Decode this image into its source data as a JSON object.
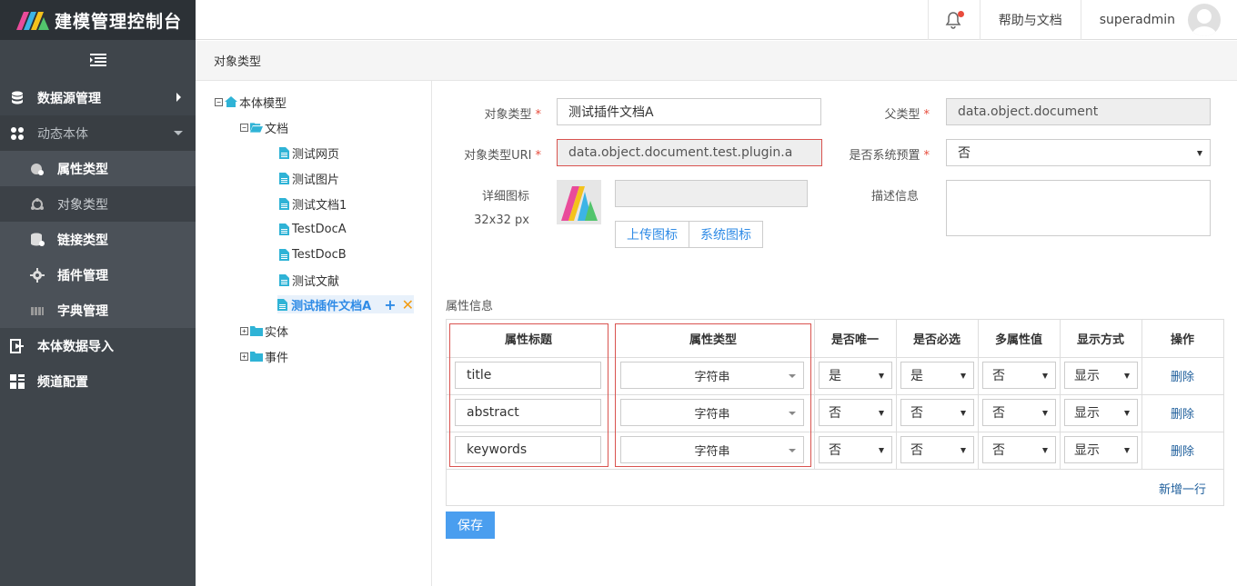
{
  "brand": {
    "title": "建模管理控制台"
  },
  "sidebar": {
    "items": [
      {
        "label": "数据源管理",
        "icon": "database-icon"
      },
      {
        "label": "动态本体",
        "icon": "ontology-icon"
      },
      {
        "label": "属性类型",
        "icon": "attribute-icon"
      },
      {
        "label": "对象类型",
        "icon": "object-type-icon"
      },
      {
        "label": "链接类型",
        "icon": "link-icon"
      },
      {
        "label": "插件管理",
        "icon": "gear-icon"
      },
      {
        "label": "字典管理",
        "icon": "dictionary-icon"
      },
      {
        "label": "本体数据导入",
        "icon": "import-icon"
      },
      {
        "label": "频道配置",
        "icon": "grid-icon"
      }
    ]
  },
  "topbar": {
    "help": "帮助与文档",
    "username": "superadmin"
  },
  "page": {
    "title": "对象类型"
  },
  "tree": {
    "root": "本体模型",
    "docs_folder": "文档",
    "docs": [
      "测试网页",
      "测试图片",
      "测试文档1",
      "TestDocA",
      "TestDocB",
      "测试文献"
    ],
    "selected": "测试插件文档A",
    "entity_folder": "实体",
    "event_folder": "事件"
  },
  "form": {
    "type_label": "对象类型",
    "type_value": "测试插件文档A",
    "parent_label": "父类型",
    "parent_value": "data.object.document",
    "uri_label": "对象类型URI",
    "uri_value": "data.object.document.test.plugin.a",
    "system_label": "是否系统预置",
    "system_value": "否",
    "icon_label": "详细图标",
    "icon_size": "32x32 px",
    "upload_btn": "上传图标",
    "system_icon_btn": "系统图标",
    "desc_label": "描述信息",
    "required_mark": "*"
  },
  "attributes": {
    "section_title": "属性信息",
    "headers": [
      "属性标题",
      "属性类型",
      "是否唯一",
      "是否必选",
      "多属性值",
      "显示方式",
      "操作"
    ],
    "rows": [
      {
        "title": "title",
        "type": "字符串",
        "unique": "是",
        "required": "是",
        "multi": "否",
        "display": "显示",
        "action": "删除"
      },
      {
        "title": "abstract",
        "type": "字符串",
        "unique": "否",
        "required": "否",
        "multi": "否",
        "display": "显示",
        "action": "删除"
      },
      {
        "title": "keywords",
        "type": "字符串",
        "unique": "否",
        "required": "否",
        "multi": "否",
        "display": "显示",
        "action": "删除"
      }
    ],
    "add_row": "新增一行"
  },
  "save_btn": "保存",
  "colors": {
    "sidebar": "#3f454b",
    "accent": "#4a9eef",
    "error": "#d9534f"
  }
}
